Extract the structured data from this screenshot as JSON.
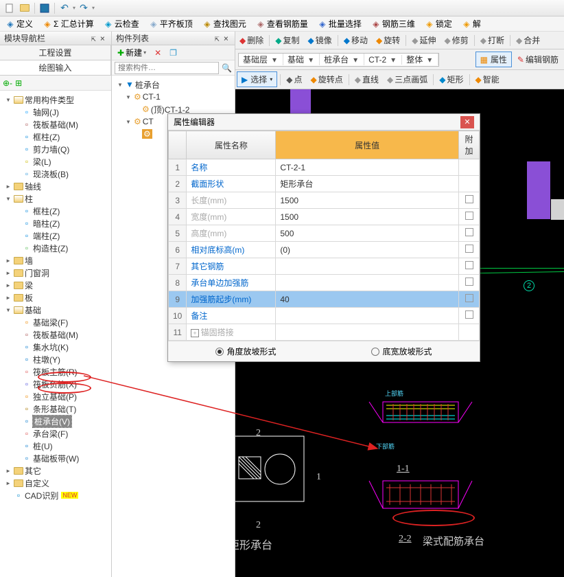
{
  "topbar": {
    "items": [
      "new",
      "open",
      "save",
      "sep",
      "undo",
      "redo",
      "sep",
      "drop1",
      "drop2"
    ]
  },
  "menubar": [
    {
      "icon": "#27b",
      "label": "定义"
    },
    {
      "icon": "#e80",
      "label": "Σ 汇总计算"
    },
    {
      "icon": "#09c",
      "label": "云检查"
    },
    {
      "icon": "#8ac",
      "label": "平齐板顶"
    },
    {
      "icon": "#b80",
      "label": "查找图元"
    },
    {
      "icon": "#a66",
      "label": "查看钢筋量"
    },
    {
      "icon": "#36c",
      "label": "批量选择"
    },
    {
      "icon": "#a44",
      "label": "钢筋三维"
    },
    {
      "icon": "#e90",
      "label": "锁定"
    },
    {
      "icon": "#e90",
      "label": "解"
    }
  ],
  "leftpanel": {
    "title": "模块导航栏",
    "tab1": "工程设置",
    "tab2": "绘图输入",
    "toolicons": [
      "park",
      "add"
    ]
  },
  "tree": [
    {
      "d": 0,
      "t": "v",
      "i": "folder-open",
      "l": "常用构件类型"
    },
    {
      "d": 1,
      "t": "",
      "i": "grid",
      "c": "#09f",
      "l": "轴网(J)"
    },
    {
      "d": 1,
      "t": "",
      "i": "slab",
      "c": "#a55",
      "l": "筏板基础(M)"
    },
    {
      "d": 1,
      "t": "",
      "i": "col",
      "c": "#08d",
      "l": "框柱(Z)"
    },
    {
      "d": 1,
      "t": "",
      "i": "wall",
      "c": "#08d",
      "l": "剪力墙(Q)"
    },
    {
      "d": 1,
      "t": "",
      "i": "beam",
      "c": "#cb0",
      "l": "梁(L)"
    },
    {
      "d": 1,
      "t": "",
      "i": "slab2",
      "c": "#39d",
      "l": "现浇板(B)"
    },
    {
      "d": 0,
      "t": ">",
      "i": "folder",
      "l": "轴线"
    },
    {
      "d": 0,
      "t": "v",
      "i": "folder-open",
      "l": "柱"
    },
    {
      "d": 1,
      "t": "",
      "i": "col",
      "c": "#08d",
      "l": "框柱(Z)"
    },
    {
      "d": 1,
      "t": "",
      "i": "col",
      "c": "#08d",
      "l": "暗柱(Z)"
    },
    {
      "d": 1,
      "t": "",
      "i": "col",
      "c": "#08d",
      "l": "端柱(Z)"
    },
    {
      "d": 1,
      "t": "",
      "i": "col",
      "c": "#5b5",
      "l": "构造柱(Z)"
    },
    {
      "d": 0,
      "t": ">",
      "i": "folder",
      "l": "墙"
    },
    {
      "d": 0,
      "t": ">",
      "i": "folder",
      "l": "门窗洞"
    },
    {
      "d": 0,
      "t": ">",
      "i": "folder",
      "l": "梁"
    },
    {
      "d": 0,
      "t": ">",
      "i": "folder",
      "l": "板"
    },
    {
      "d": 0,
      "t": "v",
      "i": "folder-open",
      "l": "基础"
    },
    {
      "d": 1,
      "t": "",
      "i": "fb",
      "c": "#e80",
      "l": "基础梁(F)"
    },
    {
      "d": 1,
      "t": "",
      "i": "slab",
      "c": "#a55",
      "l": "筏板基础(M)"
    },
    {
      "d": 1,
      "t": "",
      "i": "sump",
      "c": "#07c",
      "l": "集水坑(K)"
    },
    {
      "d": 1,
      "t": "",
      "i": "pier",
      "c": "#07c",
      "l": "柱墩(Y)"
    },
    {
      "d": 1,
      "t": "",
      "i": "rebar",
      "c": "#d55",
      "l": "筏板主筋(R)"
    },
    {
      "d": 1,
      "t": "",
      "i": "rebar",
      "c": "#55d",
      "l": "筏板负筋(X)"
    },
    {
      "d": 1,
      "t": "",
      "i": "isol",
      "c": "#e80",
      "l": "独立基础(P)"
    },
    {
      "d": 1,
      "t": "",
      "i": "strip",
      "c": "#a70",
      "l": "条形基础(T)"
    },
    {
      "d": 1,
      "t": "",
      "i": "pilecap",
      "c": "#07c",
      "l": "桩承台(V)",
      "sel": true
    },
    {
      "d": 1,
      "t": "",
      "i": "cb",
      "c": "#d55",
      "l": "承台梁(F)"
    },
    {
      "d": 1,
      "t": "",
      "i": "pile",
      "c": "#07c",
      "l": "桩(U)"
    },
    {
      "d": 1,
      "t": "",
      "i": "band",
      "c": "#07c",
      "l": "基础板带(W)"
    },
    {
      "d": 0,
      "t": ">",
      "i": "folder",
      "l": "其它"
    },
    {
      "d": 0,
      "t": ">",
      "i": "folder",
      "l": "自定义"
    },
    {
      "d": 0,
      "t": "",
      "i": "cad",
      "c": "#08c",
      "l": "CAD识别",
      "new": true
    }
  ],
  "mid": {
    "title": "构件列表",
    "new_btn": "新建",
    "search_ph": "搜索构件…",
    "tree": [
      {
        "d": 0,
        "t": "v",
        "i": "cap",
        "l": "桩承台"
      },
      {
        "d": 1,
        "t": "v",
        "i": "gear",
        "l": "CT-1"
      },
      {
        "d": 2,
        "t": "",
        "i": "gear",
        "l": "(顶)CT-1-2"
      },
      {
        "d": 1,
        "t": "v",
        "i": "gear",
        "l": "CT"
      },
      {
        "d": 2,
        "t": "",
        "i": "gearsel",
        "l": ""
      }
    ]
  },
  "rtoolbar1": [
    {
      "i": "#d33",
      "l": "删除"
    },
    {
      "sep": 1
    },
    {
      "i": "#0a8",
      "l": "复制"
    },
    {
      "i": "#07c",
      "l": "镜像"
    },
    {
      "sep": 1
    },
    {
      "i": "#07c",
      "l": "移动"
    },
    {
      "i": "#e80",
      "l": "旋转"
    },
    {
      "sep": 1
    },
    {
      "i": "#999",
      "l": "延伸"
    },
    {
      "i": "#999",
      "l": "修剪"
    },
    {
      "sep": 1
    },
    {
      "i": "#999",
      "l": "打断"
    },
    {
      "sep": 1
    },
    {
      "i": "#999",
      "l": "合并"
    }
  ],
  "rcombo": [
    "基础层",
    "基础",
    "桩承台",
    "CT-2",
    "整体"
  ],
  "rprop": {
    "l": "属性",
    "e": "编辑钢筋"
  },
  "rtoolbar2": [
    {
      "sel": true,
      "l": "选择"
    },
    {
      "sep": 1
    },
    {
      "i": "#555",
      "l": "点"
    },
    {
      "i": "#e80",
      "l": "旋转点"
    },
    {
      "sep": 1
    },
    {
      "i": "#999",
      "l": "直线"
    },
    {
      "i": "#999",
      "l": "三点画弧"
    },
    {
      "sep": 1
    },
    {
      "i": "#08c",
      "l": "矩形"
    },
    {
      "sep": 1
    },
    {
      "i": "#e80",
      "l": "智能"
    }
  ],
  "prop": {
    "title": "属性编辑器",
    "hname": "属性名称",
    "hval": "属性值",
    "hext": "附加",
    "rows": [
      {
        "n": "1",
        "name": "名称",
        "val": "CT-2-1",
        "blue": true
      },
      {
        "n": "2",
        "name": "截面形状",
        "val": "矩形承台",
        "blue": true
      },
      {
        "n": "3",
        "name": "长度(mm)",
        "val": "1500",
        "grey": true,
        "ck": true
      },
      {
        "n": "4",
        "name": "宽度(mm)",
        "val": "1500",
        "grey": true,
        "ck": true
      },
      {
        "n": "5",
        "name": "高度(mm)",
        "val": "500",
        "grey": true,
        "ck": true
      },
      {
        "n": "6",
        "name": "相对底标高(m)",
        "val": "(0)",
        "blue": true,
        "ck": true
      },
      {
        "n": "7",
        "name": "其它钢筋",
        "val": "",
        "blue": true,
        "ck": true
      },
      {
        "n": "8",
        "name": "承台单边加强筋",
        "val": "",
        "blue": true,
        "ck": true
      },
      {
        "n": "9",
        "name": "加强筋起步(mm)",
        "val": "40",
        "blue": true,
        "ck": true,
        "sel": true
      },
      {
        "n": "10",
        "name": "备注",
        "val": "",
        "blue": true,
        "ck": true
      },
      {
        "n": "11",
        "name": "锚固搭接",
        "val": "",
        "grey": true,
        "expand": true
      }
    ],
    "r1": "角度放坡形式",
    "r2": "底宽放坡形式"
  },
  "cad": {
    "rect_label": "矩形承台",
    "sec1": "1-1",
    "sec2": "2-2",
    "beam_label": "梁式配筋承台",
    "dim2": "2",
    "dim1": "1",
    "top": "上部筋",
    "bot": "下部筋",
    "node2": "2"
  }
}
